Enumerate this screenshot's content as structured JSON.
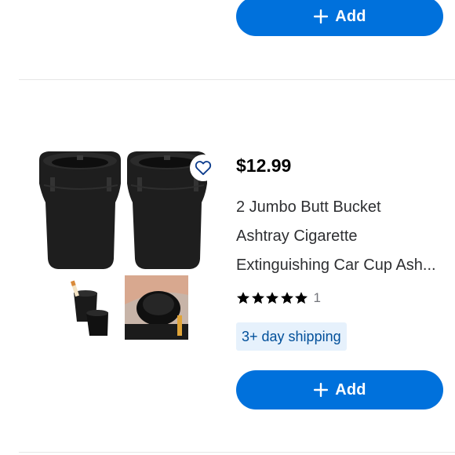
{
  "top_item": {
    "add_button_label": "Add"
  },
  "product": {
    "price": "$12.99",
    "title_lines": [
      "2 Jumbo Butt Bucket",
      "Ashtray Cigarette",
      "Extinguishing Car Cup Ash..."
    ],
    "rating": {
      "stars": 5,
      "count": "1"
    },
    "shipping_badge": "3+ day shipping",
    "add_button_label": "Add",
    "icons": {
      "favorite": "heart-outline-icon",
      "add": "plus-icon",
      "star": "star-filled-icon"
    }
  },
  "colors": {
    "accent": "#0071dc",
    "badge_bg": "#e6f1fc",
    "badge_text": "#004f9a",
    "divider": "#e6e6e6"
  }
}
